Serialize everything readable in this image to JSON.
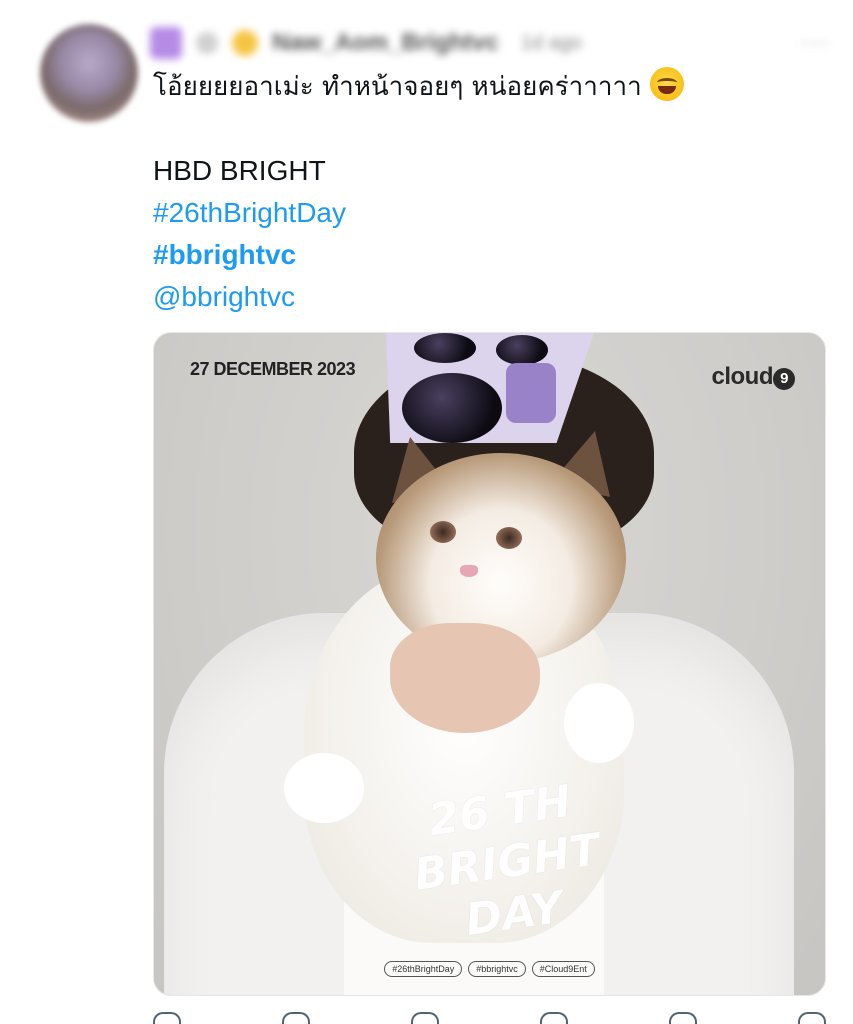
{
  "tweet": {
    "header": {
      "name": "Naw_Aom_Brightvc",
      "time": "1d ago",
      "more": "···"
    },
    "lines": {
      "thai": "โอ้ยยยยอาเม่ะ ทำหน้าจอยๆ หน่อยคร่าาาาา",
      "hbd": "HBD BRIGHT",
      "hashtag1": "#26thBrightDay",
      "hashtag2": "#bbrightvc",
      "mention": "@bbrightvc"
    },
    "emoji": "face-with-tears-of-joy-icon"
  },
  "media": {
    "date": "27 DECEMBER 2023",
    "logo_text": "cloud",
    "logo_badge": "9",
    "headline": [
      "26 TH",
      "BRIGHT",
      "DAY"
    ],
    "tags": [
      "#26thBrightDay",
      "#bbrightvc",
      "#Cloud9Ent"
    ]
  },
  "colors": {
    "link": "#1d9bf0",
    "text": "#0f1419",
    "action_icon": "#536471"
  }
}
